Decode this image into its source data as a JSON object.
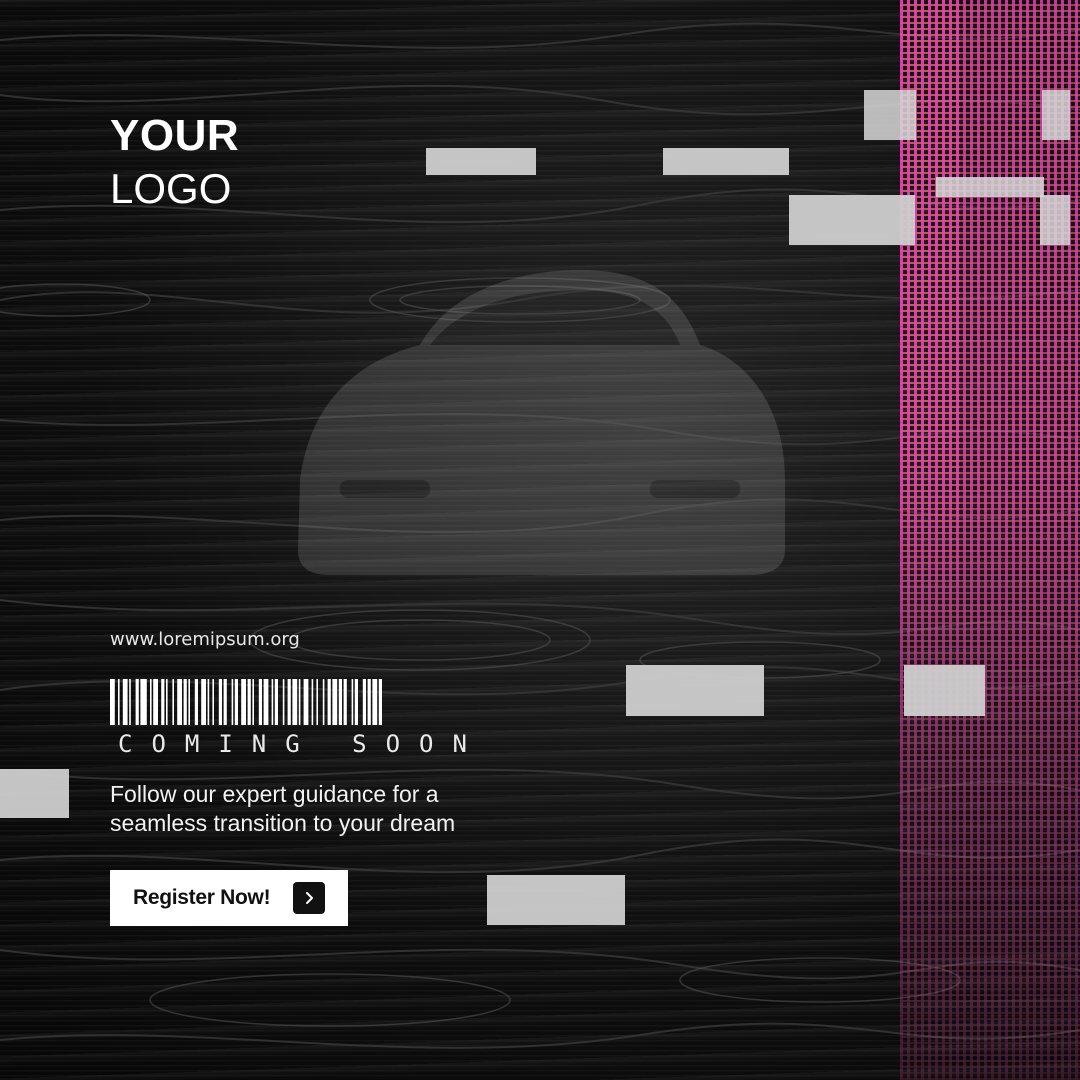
{
  "logo": {
    "line1": "YOUR",
    "line2": "LOGO"
  },
  "website": "www.loremipsum.org",
  "tagline": "COMING SOON",
  "description": "Follow our expert guidance for a seamless transition to your dream",
  "cta": {
    "label": "Register Now!",
    "icon": "chevron-right-icon"
  },
  "colors": {
    "background": "#0b0b0b",
    "text": "#ffffff",
    "glitch_pink": "#ff3cc8",
    "glitch_orange": "#ff8c5a",
    "block_gray": "#cfcfcf"
  },
  "decor": {
    "barcode": "barcode-graphic",
    "background_image": "car-silhouette"
  }
}
